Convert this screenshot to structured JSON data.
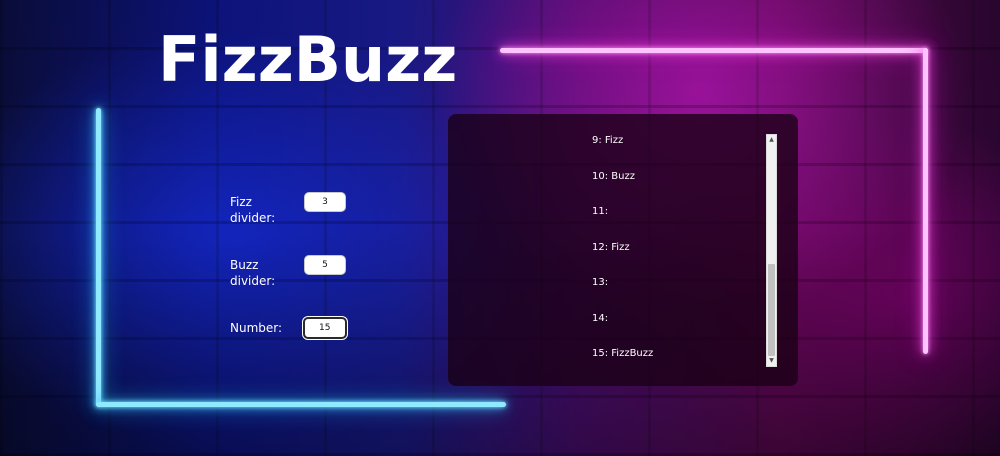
{
  "app": {
    "title": "FizzBuzz"
  },
  "form": {
    "fizz_label": "Fizz divider:",
    "fizz_value": "3",
    "buzz_label": "Buzz divider:",
    "buzz_value": "5",
    "number_label": "Number:",
    "number_value": "15"
  },
  "output": {
    "items": [
      "9: Fizz",
      "10: Buzz",
      "11:",
      "12: Fizz",
      "13:",
      "14:",
      "15: FizzBuzz"
    ],
    "scroll_position": 1.0
  },
  "theme": {
    "neon_blue": "#8fe9ff",
    "neon_pink": "#ffc4ff",
    "panel_bg": "#190014",
    "text_color": "#ffffff"
  },
  "icons": {
    "scroll_up": "scroll-up-arrow-icon",
    "scroll_down": "scroll-down-arrow-icon"
  }
}
